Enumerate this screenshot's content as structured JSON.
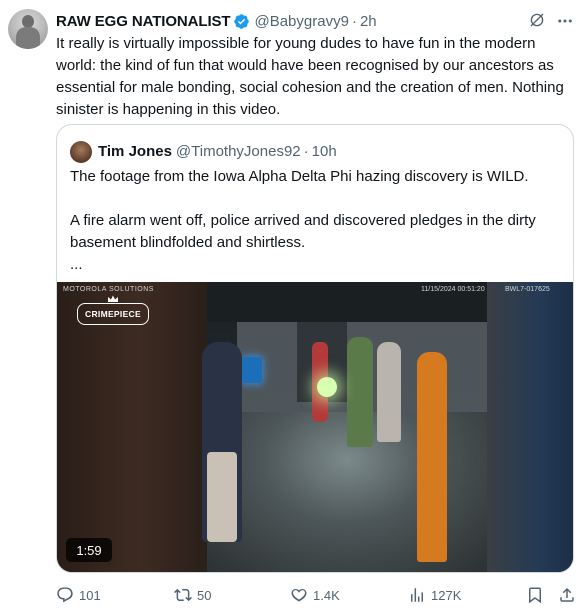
{
  "tweet": {
    "author": {
      "name": "RAW EGG NATIONALIST",
      "handle": "@Babygravy9",
      "time": "2h",
      "separator": "·"
    },
    "text": "It really is virtually impossible for young dudes to have fun in the modern world: the kind of fun that would have been recognised by our ancestors as essential for male bonding, social cohesion and the creation of men. Nothing sinister is happening in this video.",
    "quote": {
      "author": {
        "name": "Tim Jones",
        "handle": "@TimothyJones92",
        "time": "10h",
        "separator": "·"
      },
      "text": "The footage from the Iowa Alpha Delta Phi hazing discovery is WILD.\n\nA fire alarm went off, police arrived and discovered pledges in the dirty basement blindfolded and shirtless.\n...",
      "video": {
        "brand": "MOTOROLA SOLUTIONS",
        "timestamp": "11/15/2024 00:51:20",
        "camera_id": "BWL7-017625",
        "watermark": "CRIMEPIECE",
        "duration": "1:59"
      }
    },
    "actions": {
      "replies": "101",
      "reposts": "50",
      "likes": "1.4K",
      "views": "127K"
    },
    "icons": {
      "verified": "verified-badge-icon",
      "grok": "grok-icon",
      "more": "more-icon",
      "reply": "reply-icon",
      "repost": "repost-icon",
      "like": "like-icon",
      "views": "views-icon",
      "bookmark": "bookmark-icon",
      "share": "share-icon"
    },
    "colors": {
      "verified": "#1d9bf0",
      "secondary_text": "#536471",
      "border": "#cfd9de"
    }
  }
}
